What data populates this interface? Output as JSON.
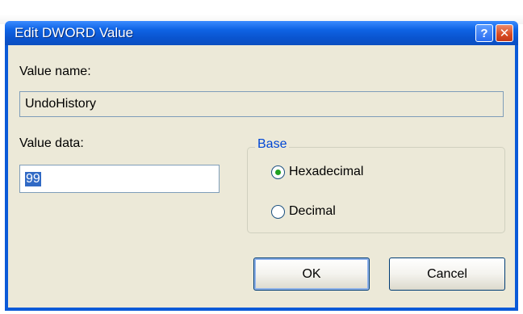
{
  "dialog": {
    "title": "Edit DWORD Value",
    "help_glyph": "?",
    "close_glyph": "✕",
    "value_name_label": "Value name:",
    "value_name": "UndoHistory",
    "value_data_label": "Value data:",
    "value_data": "99",
    "base_group_label": "Base",
    "radio_hex_label": "Hexadecimal",
    "radio_dec_label": "Decimal",
    "selected_base": "Hexadecimal",
    "ok_label": "OK",
    "cancel_label": "Cancel"
  },
  "colors": {
    "titlebar": "#0a54cf",
    "client_bg": "#ece9d8",
    "selection": "#316ac5",
    "group_label": "#0046d5",
    "radio_dot": "#21a121"
  }
}
